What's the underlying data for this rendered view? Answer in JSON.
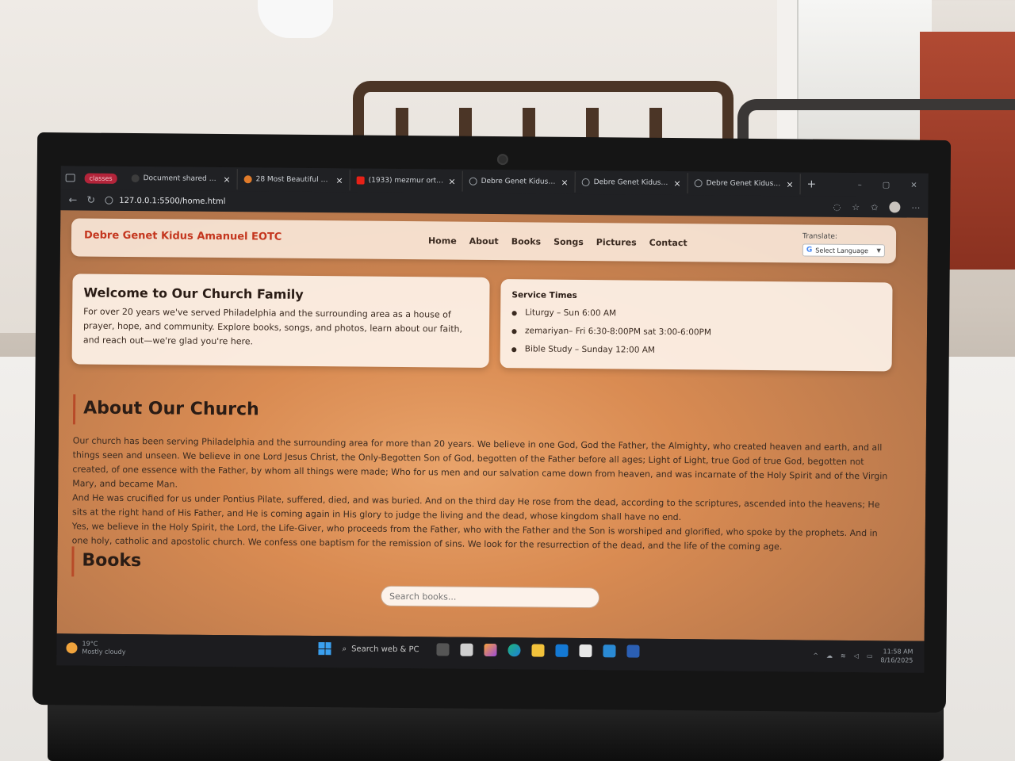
{
  "browser": {
    "tab_group": "classes",
    "tabs": [
      {
        "title": "Document shared with yo",
        "fav_color": "#3c3c3c"
      },
      {
        "title": "28 Most Beautiful Website",
        "fav_color": "#e07b2a"
      },
      {
        "title": "(1933) mezmur orthodox",
        "fav_color": "#e62117"
      },
      {
        "title": "Debre Genet Kidus Aman",
        "fav_color": "#9aa0a6"
      },
      {
        "title": "Debre Genet Kidus Aman",
        "fav_color": "#9aa0a6"
      },
      {
        "title": "Debre Genet Kidus Aman",
        "fav_color": "#9aa0a6"
      }
    ],
    "url": "127.0.0.1:5500/home.html"
  },
  "site": {
    "brand": "Debre Genet Kidus Amanuel EOTC",
    "nav": [
      "Home",
      "About",
      "Books",
      "Songs",
      "Pictures",
      "Contact"
    ],
    "translate_label": "Translate:",
    "language_select": "Select Language",
    "welcome": {
      "title": "Welcome to Our Church Family",
      "text": "For over 20 years we've served Philadelphia and the surrounding area as a house of prayer, hope, and community. Explore books, songs, and photos, learn about our faith, and reach out—we're glad you're here."
    },
    "service": {
      "title": "Service Times",
      "items": [
        "Liturgy – Sun 6:00 AM",
        "zemariyan– Fri 6:30-8:00PM sat 3:00-6:00PM",
        "Bible Study – Sunday 12:00 AM"
      ]
    },
    "about": {
      "title": "About Our Church",
      "paragraphs": [
        "Our church has been serving Philadelphia and the surrounding area for more than 20 years. We believe in one God, God the Father, the Almighty, who created heaven and earth, and all things seen and unseen. We believe in one Lord Jesus Christ, the Only-Begotten Son of God, begotten of the Father before all ages; Light of Light, true God of true God, begotten not created, of one essence with the Father, by whom all things were made; Who for us men and our salvation came down from heaven, and was incarnate of the Holy Spirit and of the Virgin Mary, and became Man.",
        "And He was crucified for us under Pontius Pilate, suffered, died, and was buried. And on the third day He rose from the dead, according to the scriptures, ascended into the heavens; He sits at the right hand of His Father, and He is coming again in His glory to judge the living and the dead, whose kingdom shall have no end.",
        "Yes, we believe in the Holy Spirit, the Lord, the Life-Giver, who proceeds from the Father, who with the Father and the Son is worshiped and glorified, who spoke by the prophets. And in one holy, catholic and apostolic church. We confess one baptism for the remission of sins. We look for the resurrection of the dead, and the life of the coming age."
      ]
    },
    "books": {
      "title": "Books",
      "search_placeholder": "Search books..."
    }
  },
  "taskbar": {
    "weather_temp": "19°C",
    "weather_desc": "Mostly cloudy",
    "search_label": "Search web & PC",
    "time": "11:58 AM",
    "date": "8/16/2025"
  }
}
